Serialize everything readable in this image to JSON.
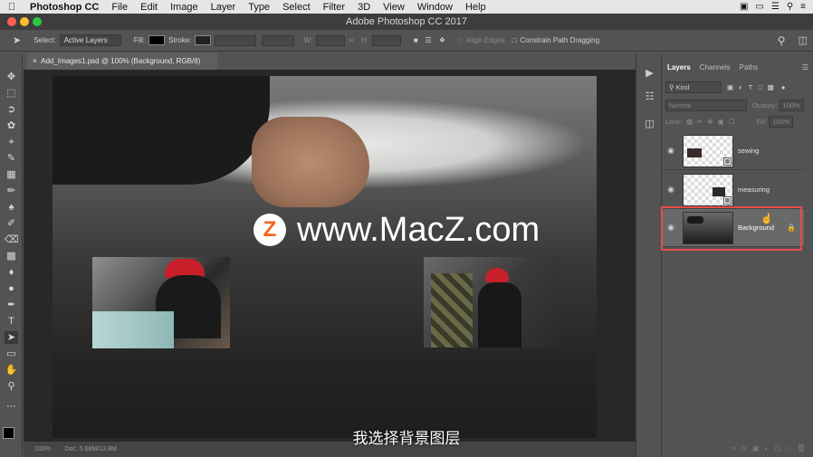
{
  "menubar": {
    "app_name": "Photoshop CC",
    "items": [
      "File",
      "Edit",
      "Image",
      "Layer",
      "Type",
      "Select",
      "Filter",
      "3D",
      "View",
      "Window",
      "Help"
    ]
  },
  "window": {
    "title": "Adobe Photoshop CC 2017"
  },
  "options_bar": {
    "select_label": "Select:",
    "select_value": "Active Layers",
    "fill_label": "Fill:",
    "stroke_label": "Stroke:",
    "w_label": "W:",
    "h_label": "H:",
    "align_edges_label": "Align Edges",
    "constrain_label": "Constrain Path Dragging"
  },
  "document_tab": {
    "close": "×",
    "label": "Add_Images1.psd @ 100% (Background, RGB/8)"
  },
  "watermark": {
    "logo": "Z",
    "text": "www.MacZ.com"
  },
  "subtitle": "我选择背景图层",
  "status_bar": {
    "zoom": "100%",
    "doc": "Doc: 5.68M/13.8M"
  },
  "layers_panel": {
    "tabs": [
      "Layers",
      "Channels",
      "Paths"
    ],
    "kind_filter": "Kind",
    "blend_mode": "Normal",
    "opacity_label": "Opacity:",
    "opacity_value": "100%",
    "lock_label": "Lock:",
    "fill_label": "Fill:",
    "fill_value": "100%",
    "layers": [
      {
        "name": "sewing",
        "visible": true,
        "selected": false
      },
      {
        "name": "measuring",
        "visible": true,
        "selected": false
      },
      {
        "name": "Background",
        "visible": true,
        "selected": true,
        "locked": true
      }
    ]
  },
  "colors": {
    "highlight": "#e84a4a",
    "panel_bg": "#535353",
    "canvas_bg": "#282828"
  }
}
